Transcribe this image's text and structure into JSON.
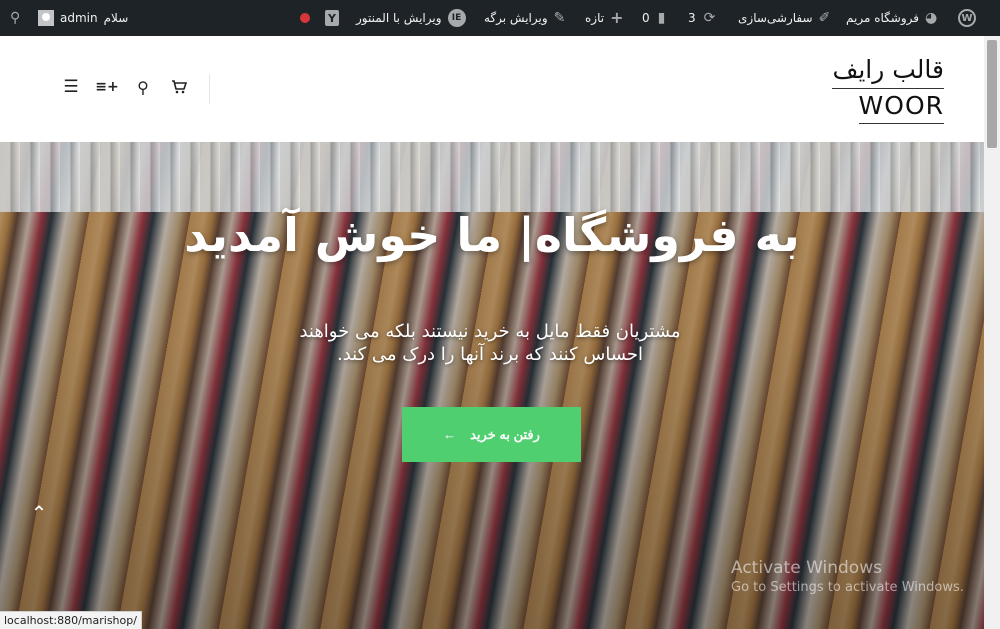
{
  "adminbar": {
    "user_greeting": "سلام",
    "user_name": "admin",
    "view_elementor": "ویرایش با المنتور",
    "edit_page": "ویرایش برگه",
    "new": "تازه",
    "comments_count": "0",
    "updates_count": "3",
    "customize": "سفارشی‌سازی",
    "site_name": "فروشگاه مریم",
    "yoast_letter": "Y"
  },
  "header": {
    "title_line1": "قالب رایف",
    "title_line2": "WOOR"
  },
  "hero": {
    "title": "به فروشگاه| ما خوش آمدید",
    "subtitle_line1": "مشتریان فقط مایل به خرید نیستند بلکه می خواهند",
    "subtitle_line2": "احساس کنند که برند آنها را درک می کند.",
    "button_label": "رفتن به خرید",
    "button_arrow": "←",
    "back_to_top": "⌃"
  },
  "watermark": {
    "line1": "Activate Windows",
    "line2": "Go to Settings to activate Windows."
  },
  "status_url": "localhost:880/marishop/",
  "colors": {
    "adminbar_bg": "#1d2327",
    "button_bg": "#4fcf70"
  }
}
